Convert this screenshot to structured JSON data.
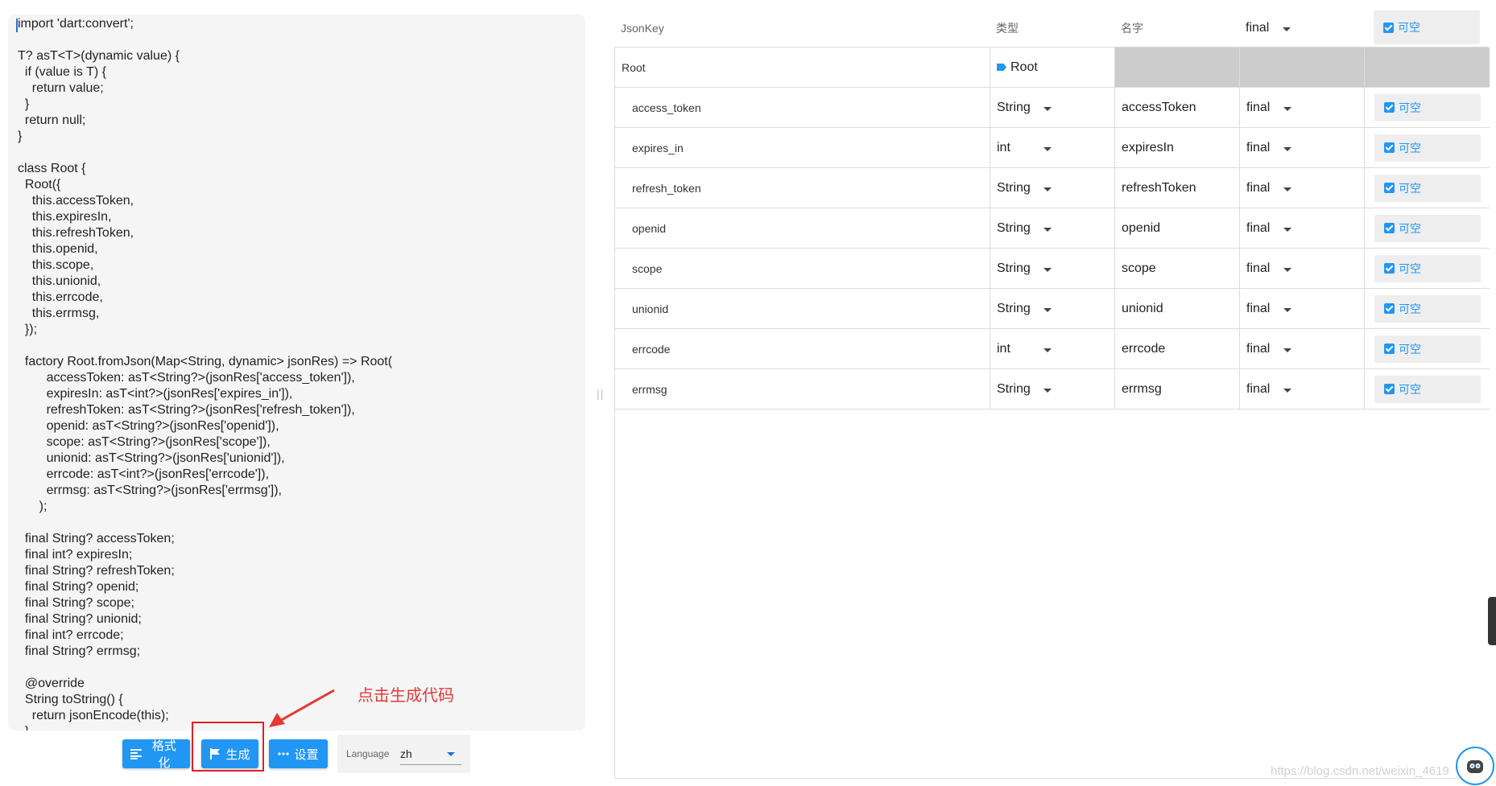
{
  "code": {
    "text": "import 'dart:convert';\n\nT? asT<T>(dynamic value) {\n  if (value is T) {\n    return value;\n  }\n  return null;\n}\n\nclass Root {\n  Root({\n    this.accessToken,\n    this.expiresIn,\n    this.refreshToken,\n    this.openid,\n    this.scope,\n    this.unionid,\n    this.errcode,\n    this.errmsg,\n  });\n\n  factory Root.fromJson(Map<String, dynamic> jsonRes) => Root(\n        accessToken: asT<String?>(jsonRes['access_token']),\n        expiresIn: asT<int?>(jsonRes['expires_in']),\n        refreshToken: asT<String?>(jsonRes['refresh_token']),\n        openid: asT<String?>(jsonRes['openid']),\n        scope: asT<String?>(jsonRes['scope']),\n        unionid: asT<String?>(jsonRes['unionid']),\n        errcode: asT<int?>(jsonRes['errcode']),\n        errmsg: asT<String?>(jsonRes['errmsg']),\n      );\n\n  final String? accessToken;\n  final int? expiresIn;\n  final String? refreshToken;\n  final String? openid;\n  final String? scope;\n  final String? unionid;\n  final int? errcode;\n  final String? errmsg;\n\n  @override\n  String toString() {\n    return jsonEncode(this);\n  }"
  },
  "toolbar": {
    "format_label": "格式化",
    "generate_label": "生成",
    "settings_label": "设置",
    "language_label": "Language",
    "language_value": "zh"
  },
  "annotation": {
    "text": "点击生成代码",
    "color": "#e53935"
  },
  "table": {
    "headers": {
      "json_key": "JsonKey",
      "type": "类型",
      "name": "名字",
      "final": "final",
      "nullable": "可空"
    },
    "root": {
      "key": "Root",
      "type": "Root"
    },
    "rows": [
      {
        "key": "access_token",
        "type": "String",
        "name": "accessToken",
        "modifier": "final",
        "nullable": "可空"
      },
      {
        "key": "expires_in",
        "type": "int",
        "name": "expiresIn",
        "modifier": "final",
        "nullable": "可空"
      },
      {
        "key": "refresh_token",
        "type": "String",
        "name": "refreshToken",
        "modifier": "final",
        "nullable": "可空"
      },
      {
        "key": "openid",
        "type": "String",
        "name": "openid",
        "modifier": "final",
        "nullable": "可空"
      },
      {
        "key": "scope",
        "type": "String",
        "name": "scope",
        "modifier": "final",
        "nullable": "可空"
      },
      {
        "key": "unionid",
        "type": "String",
        "name": "unionid",
        "modifier": "final",
        "nullable": "可空"
      },
      {
        "key": "errcode",
        "type": "int",
        "name": "errcode",
        "modifier": "final",
        "nullable": "可空"
      },
      {
        "key": "errmsg",
        "type": "String",
        "name": "errmsg",
        "modifier": "final",
        "nullable": "可空"
      }
    ]
  },
  "watermark": "https://blog.csdn.net/weixin_4619",
  "icons": {
    "format": "align-left-icon",
    "generate": "flag-icon",
    "settings": "more-horizontal-icon",
    "checkbox": "checkbox-checked-icon",
    "dropdown": "caret-down-icon",
    "root_tag": "tag-icon"
  },
  "colors": {
    "primary": "#2196f3",
    "highlight": "#e02020",
    "code_bg": "#f5f5f5",
    "root_fill": "#cccccc"
  }
}
